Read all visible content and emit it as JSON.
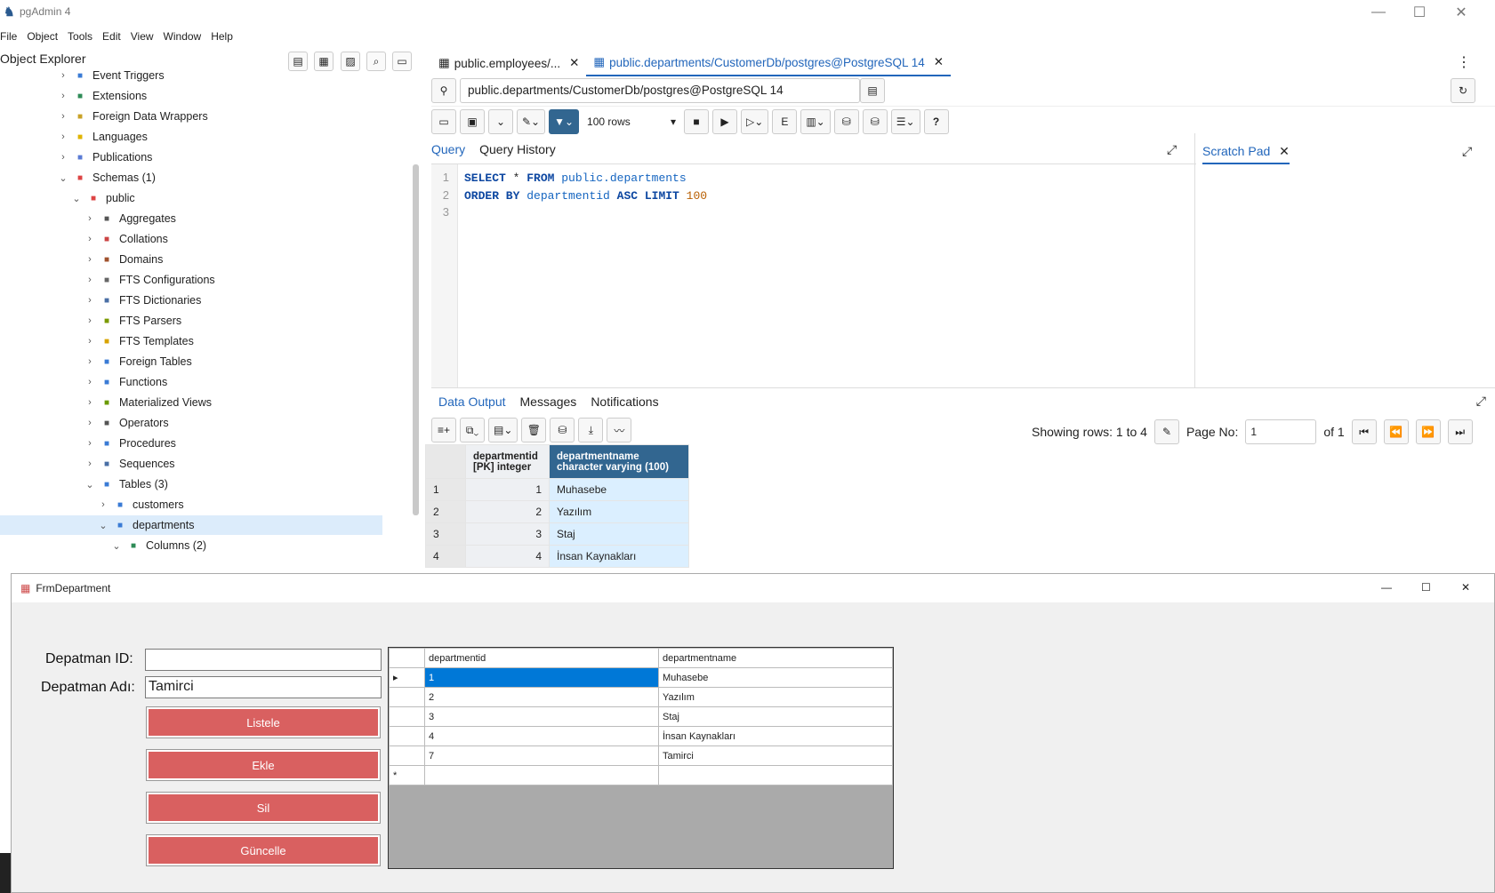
{
  "window": {
    "title": "pgAdmin 4"
  },
  "menu": [
    "File",
    "Object",
    "Tools",
    "Edit",
    "View",
    "Window",
    "Help"
  ],
  "explorer": {
    "title": "Object Explorer"
  },
  "tree": [
    {
      "label": "Event Triggers",
      "level": 0,
      "exp": ">"
    },
    {
      "label": "Extensions",
      "level": 0,
      "exp": ">"
    },
    {
      "label": "Foreign Data Wrappers",
      "level": 0,
      "exp": ">"
    },
    {
      "label": "Languages",
      "level": 0,
      "exp": ">"
    },
    {
      "label": "Publications",
      "level": 0,
      "exp": ">"
    },
    {
      "label": "Schemas (1)",
      "level": 0,
      "exp": "v"
    },
    {
      "label": "public",
      "level": 1,
      "exp": "v"
    },
    {
      "label": "Aggregates",
      "level": 2,
      "exp": ">"
    },
    {
      "label": "Collations",
      "level": 2,
      "exp": ">"
    },
    {
      "label": "Domains",
      "level": 2,
      "exp": ">"
    },
    {
      "label": "FTS Configurations",
      "level": 2,
      "exp": ">"
    },
    {
      "label": "FTS Dictionaries",
      "level": 2,
      "exp": ">"
    },
    {
      "label": "FTS Parsers",
      "level": 2,
      "exp": ">"
    },
    {
      "label": "FTS Templates",
      "level": 2,
      "exp": ">"
    },
    {
      "label": "Foreign Tables",
      "level": 2,
      "exp": ">"
    },
    {
      "label": "Functions",
      "level": 2,
      "exp": ">"
    },
    {
      "label": "Materialized Views",
      "level": 2,
      "exp": ">"
    },
    {
      "label": "Operators",
      "level": 2,
      "exp": ">"
    },
    {
      "label": "Procedures",
      "level": 2,
      "exp": ">"
    },
    {
      "label": "Sequences",
      "level": 2,
      "exp": ">"
    },
    {
      "label": "Tables (3)",
      "level": 2,
      "exp": "v"
    },
    {
      "label": "customers",
      "level": 3,
      "exp": ">"
    },
    {
      "label": "departments",
      "level": 3,
      "exp": "v",
      "selected": true
    },
    {
      "label": "Columns (2)",
      "level": 4,
      "exp": "v"
    }
  ],
  "tabs": [
    {
      "label": "public.employees/..."
    },
    {
      "label": "public.departments/CustomerDb/postgres@PostgreSQL 14"
    }
  ],
  "connection": "public.departments/CustomerDb/postgres@PostgreSQL 14",
  "rows_limit": "100 rows",
  "query_tabs": {
    "query": "Query",
    "history": "Query History",
    "scratch": "Scratch Pad"
  },
  "sql": {
    "line1": {
      "k1": "SELECT",
      "star": " * ",
      "k2": "FROM",
      "t": " public.departments"
    },
    "line2": {
      "k1": "ORDER BY",
      "col": " departmentid ",
      "k2": "ASC LIMIT",
      "n": " 100"
    }
  },
  "output_tabs": [
    "Data Output",
    "Messages",
    "Notifications"
  ],
  "rows_info": {
    "showing": "Showing rows: 1 to 4",
    "page_label": "Page No:",
    "page": "1",
    "of": "of 1"
  },
  "grid": {
    "col1": {
      "name": "departmentid",
      "type": "[PK] integer"
    },
    "col2": {
      "name": "departmentname",
      "type": "character varying (100)"
    },
    "rows": [
      {
        "n": "1",
        "id": "1",
        "name": "Muhasebe"
      },
      {
        "n": "2",
        "id": "2",
        "name": "Yazılım"
      },
      {
        "n": "3",
        "id": "3",
        "name": "Staj"
      },
      {
        "n": "4",
        "id": "4",
        "name": "İnsan Kaynakları"
      }
    ]
  },
  "form": {
    "title": "FrmDepartment",
    "id_label": "Depatman ID:",
    "id_value": "",
    "name_label": "Depatman Adı:",
    "name_value": "Tamirci",
    "buttons": [
      "Listele",
      "Ekle",
      "Sil",
      "Güncelle"
    ],
    "dgv": {
      "headers": [
        "departmentid",
        "departmentname"
      ],
      "rows": [
        {
          "id": "1",
          "name": "Muhasebe"
        },
        {
          "id": "2",
          "name": "Yazılım"
        },
        {
          "id": "3",
          "name": "Staj"
        },
        {
          "id": "4",
          "name": "İnsan Kaynakları"
        },
        {
          "id": "7",
          "name": "Tamirci"
        }
      ]
    }
  }
}
